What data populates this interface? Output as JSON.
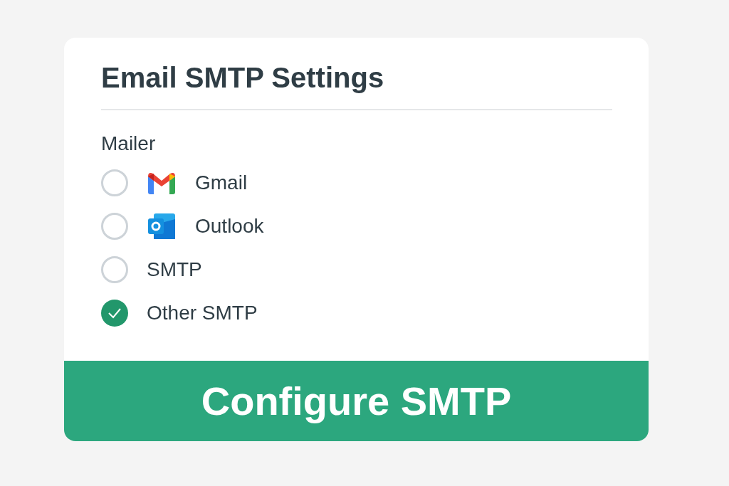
{
  "title": "Email SMTP Settings",
  "mailer": {
    "label": "Mailer",
    "options": [
      {
        "label": "Gmail",
        "kind": "gmail",
        "selected": false
      },
      {
        "label": "Outlook",
        "kind": "outlook",
        "selected": false
      },
      {
        "label": "SMTP",
        "kind": "plain",
        "selected": false
      },
      {
        "label": "Other SMTP",
        "kind": "plain",
        "selected": true
      }
    ]
  },
  "button": "Configure SMTP"
}
